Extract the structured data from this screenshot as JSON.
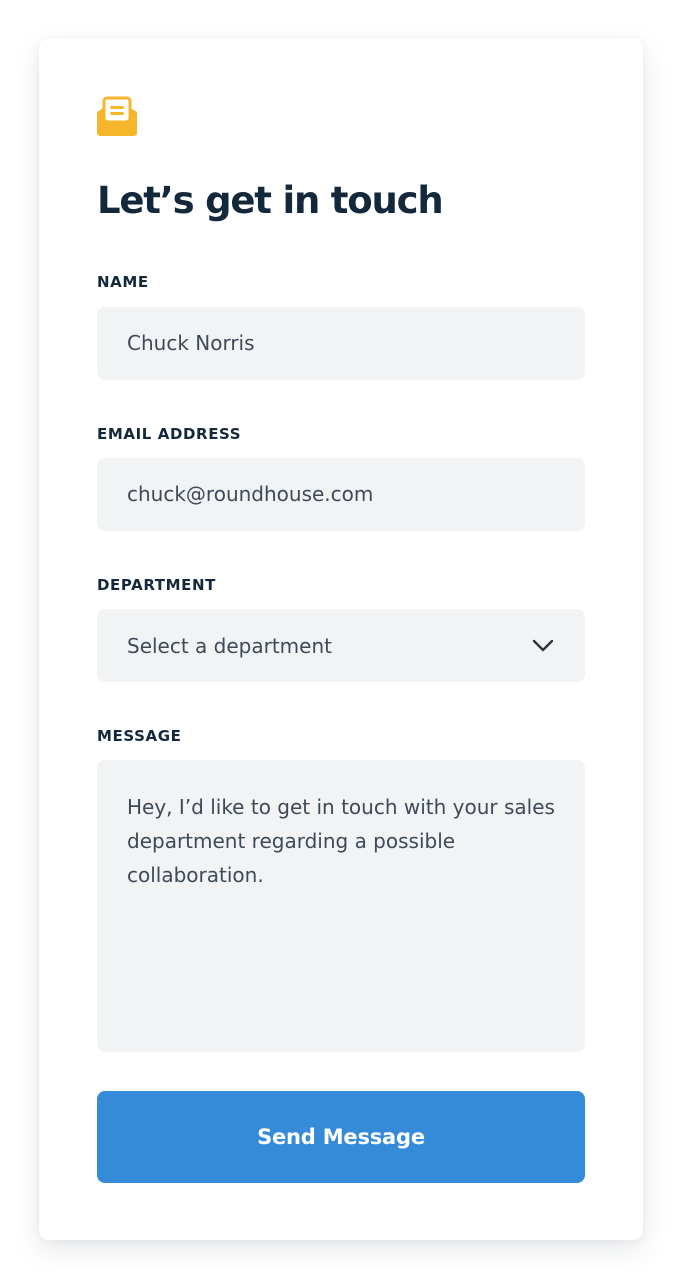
{
  "form": {
    "title": "Let’s get in touch",
    "icon": "mail-open-icon",
    "accent_color": "#f5b62c",
    "fields": {
      "name": {
        "label": "NAME",
        "value": "Chuck Norris"
      },
      "email": {
        "label": "EMAIL ADDRESS",
        "value": "chuck@roundhouse.com"
      },
      "department": {
        "label": "DEPARTMENT",
        "selected": "Select a department"
      },
      "message": {
        "label": "MESSAGE",
        "value": "Hey, I’d like to get in touch with your sales department regarding a possible collaboration."
      }
    },
    "submit_label": "Send Message",
    "button_color": "#358bd7"
  }
}
